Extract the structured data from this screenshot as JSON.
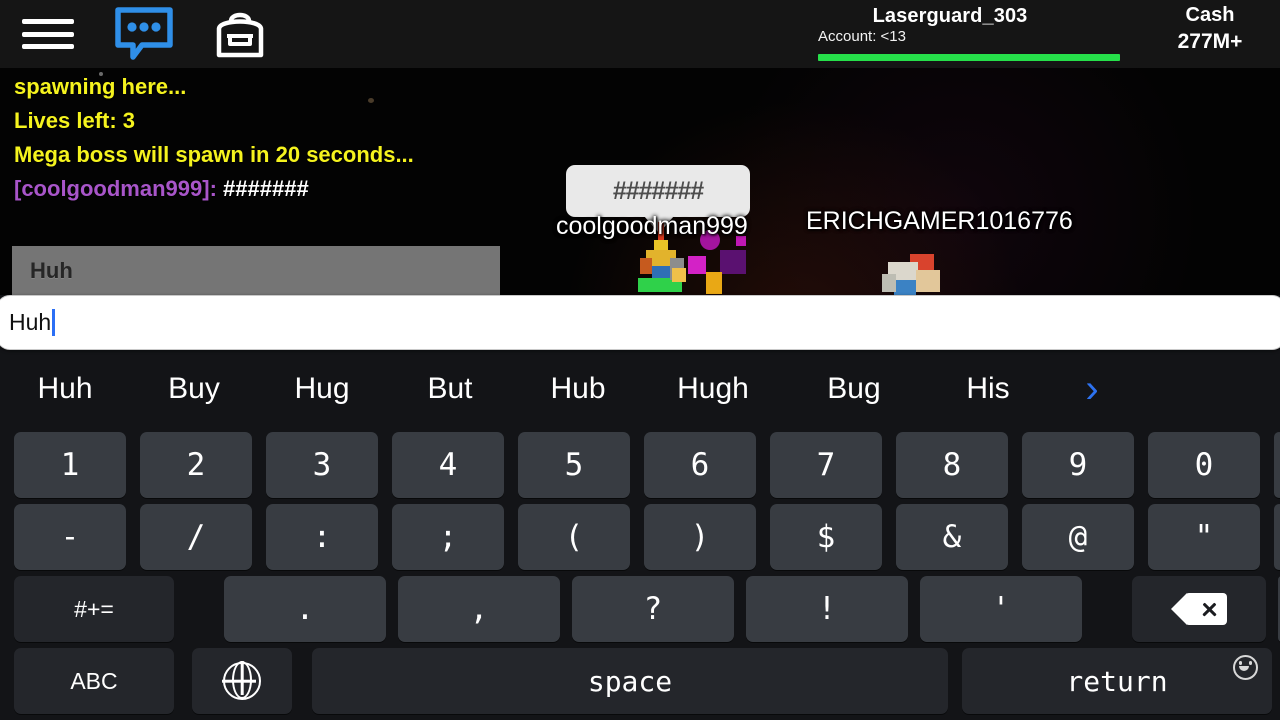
{
  "topbar": {
    "icons": [
      {
        "name": "hamburger-menu-icon",
        "label": "Menu"
      },
      {
        "name": "chat-bubble-icon",
        "label": "Chat"
      },
      {
        "name": "backpack-icon",
        "label": "Backpack"
      }
    ],
    "player_name": "Laserguard_303",
    "account_label": "Account: <13",
    "health_percent": 100,
    "cash_label": "Cash",
    "cash_value": "277M+",
    "health_color": "#26e04a",
    "chat_icon_color": "#2f8fe8"
  },
  "chat_log": {
    "lines": [
      {
        "type": "system",
        "text": "spawning here..."
      },
      {
        "type": "system",
        "text": "Lives left: 3"
      },
      {
        "type": "system",
        "text": "Mega boss will spawn in 20 seconds..."
      },
      {
        "type": "player",
        "speaker": "[coolgoodman999]:",
        "message": "#######"
      }
    ],
    "system_color": "#f5f31e",
    "speaker_color": "#a855c9"
  },
  "ingame_input": {
    "text": "Huh"
  },
  "world": {
    "speech_bubble_text": "#######",
    "nameplates": [
      {
        "name": "coolgoodman999"
      },
      {
        "name": "ERICHGAMER1016776"
      }
    ]
  },
  "keyboard": {
    "input_value": "Huh",
    "suggestions": [
      "Huh",
      "Buy",
      "Hug",
      "But",
      "Hub",
      "Hugh",
      "Bug",
      "His"
    ],
    "suggestion_more_icon": "chevron-right-icon",
    "emoji_button_icon": "smiley-face-icon",
    "rows": [
      {
        "id": "number-row",
        "keys": [
          {
            "label": "1",
            "name": "key-1",
            "type": "char"
          },
          {
            "label": "2",
            "name": "key-2",
            "type": "char"
          },
          {
            "label": "3",
            "name": "key-3",
            "type": "char"
          },
          {
            "label": "4",
            "name": "key-4",
            "type": "char"
          },
          {
            "label": "5",
            "name": "key-5",
            "type": "char"
          },
          {
            "label": "6",
            "name": "key-6",
            "type": "char"
          },
          {
            "label": "7",
            "name": "key-7",
            "type": "char"
          },
          {
            "label": "8",
            "name": "key-8",
            "type": "char"
          },
          {
            "label": "9",
            "name": "key-9",
            "type": "char"
          },
          {
            "label": "0",
            "name": "key-0",
            "type": "char"
          }
        ]
      },
      {
        "id": "symbol-row",
        "keys": [
          {
            "label": "-",
            "name": "key-hyphen",
            "type": "char"
          },
          {
            "label": "/",
            "name": "key-slash",
            "type": "char"
          },
          {
            "label": ":",
            "name": "key-colon",
            "type": "char"
          },
          {
            "label": ";",
            "name": "key-semicolon",
            "type": "char"
          },
          {
            "label": "(",
            "name": "key-paren-open",
            "type": "char"
          },
          {
            "label": ")",
            "name": "key-paren-close",
            "type": "char"
          },
          {
            "label": "$",
            "name": "key-dollar",
            "type": "char"
          },
          {
            "label": "&",
            "name": "key-ampersand",
            "type": "char"
          },
          {
            "label": "@",
            "name": "key-at",
            "type": "char"
          },
          {
            "label": "\"",
            "name": "key-quote",
            "type": "char"
          }
        ]
      },
      {
        "id": "punctuation-row",
        "keys": [
          {
            "label": "#+=",
            "name": "key-more-symbols",
            "type": "mod"
          },
          {
            "label": ".",
            "name": "key-period",
            "type": "char"
          },
          {
            "label": ",",
            "name": "key-comma",
            "type": "char"
          },
          {
            "label": "?",
            "name": "key-question",
            "type": "char"
          },
          {
            "label": "!",
            "name": "key-exclamation",
            "type": "char"
          },
          {
            "label": "'",
            "name": "key-apostrophe",
            "type": "char"
          },
          {
            "label": "",
            "name": "key-backspace",
            "type": "backspace"
          }
        ]
      },
      {
        "id": "bottom-row",
        "keys": [
          {
            "label": "ABC",
            "name": "key-abc",
            "type": "mod"
          },
          {
            "label": "",
            "name": "key-globe",
            "type": "globe"
          },
          {
            "label": "space",
            "name": "key-space",
            "type": "space"
          },
          {
            "label": "return",
            "name": "key-return",
            "type": "return"
          }
        ]
      }
    ],
    "key_color": "#383c42",
    "mod_key_color": "#24262b",
    "background_color": "#131417"
  }
}
